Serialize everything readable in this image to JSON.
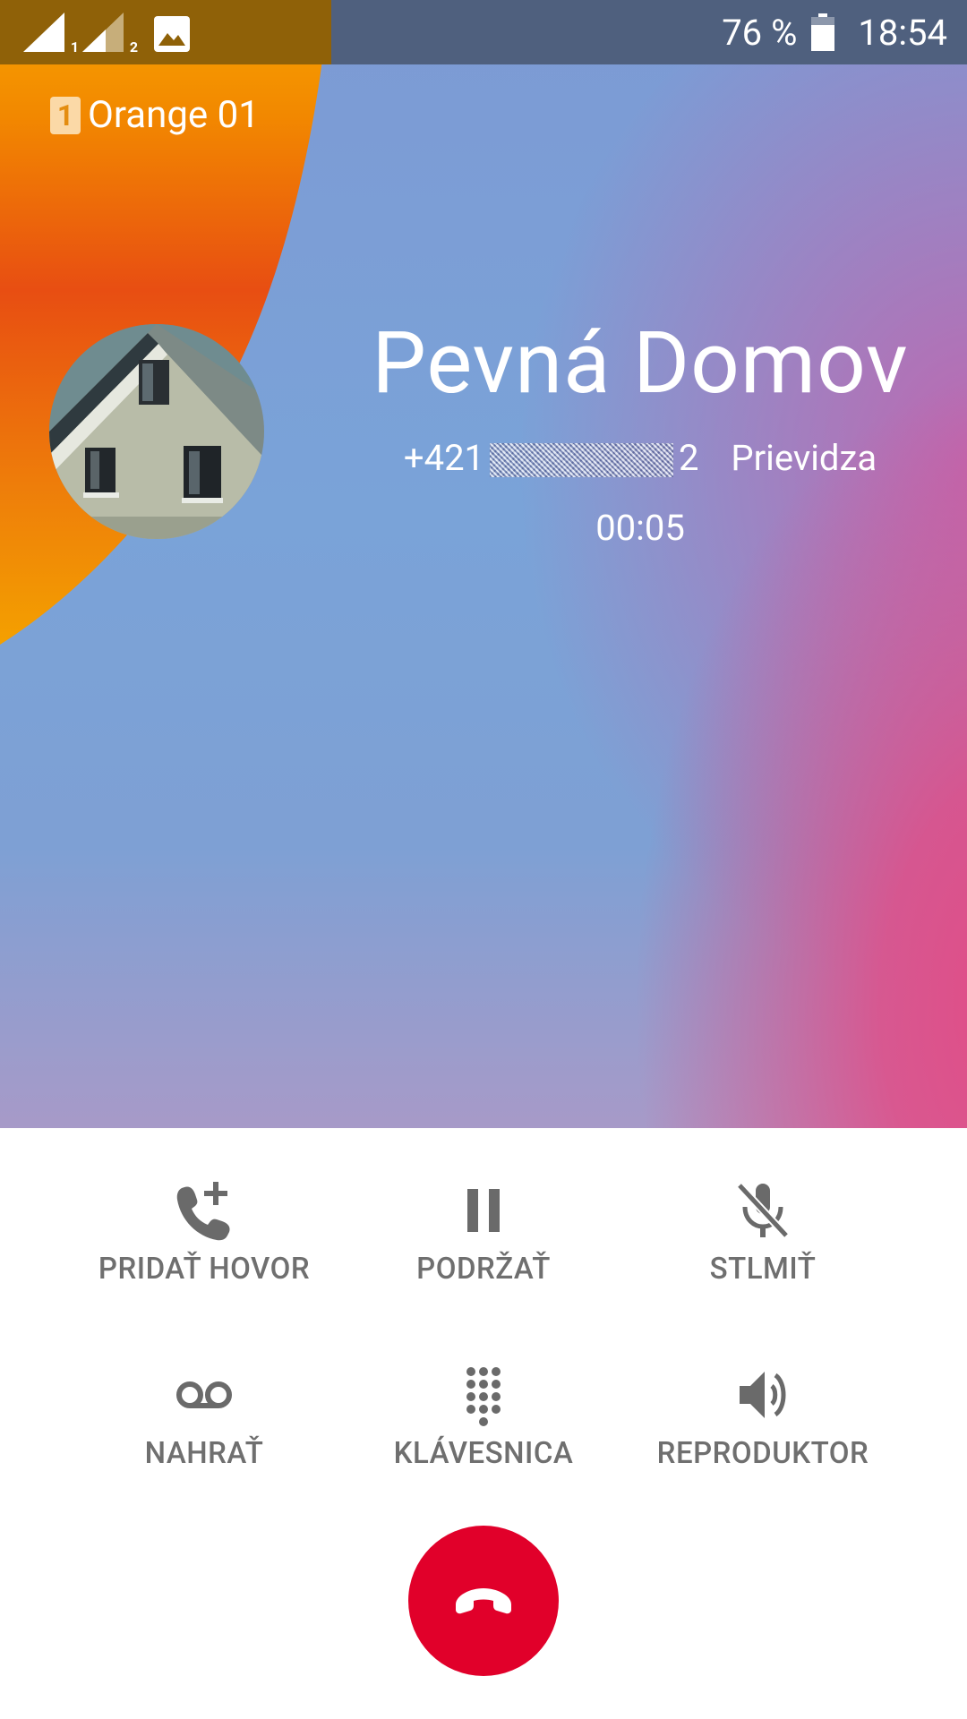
{
  "status_bar": {
    "sim1_index": "1",
    "sim2_index": "2",
    "battery": "76 %",
    "time": "18:54",
    "icons": [
      "signal-sim1-icon",
      "signal-sim2-icon",
      "gallery-notification-icon",
      "battery-icon"
    ]
  },
  "carrier": {
    "sim_slot": "1",
    "name": "Orange 01"
  },
  "contact": {
    "name": "Pevná Domov",
    "number_prefix": "+421",
    "number_suffix": "2",
    "location": "Prievidza",
    "timer": "00:05"
  },
  "controls": {
    "row1": [
      {
        "label": "PRIDAŤ HOVOR",
        "icon": "add-call-icon"
      },
      {
        "label": "PODRŽAŤ",
        "icon": "pause-icon"
      },
      {
        "label": "STLMIŤ",
        "icon": "mic-off-icon"
      }
    ],
    "row2": [
      {
        "label": "NAHRAŤ",
        "icon": "voicemail-record-icon"
      },
      {
        "label": "KLÁVESNICA",
        "icon": "dialpad-icon"
      },
      {
        "label": "REPRODUKTOR",
        "icon": "speaker-icon"
      }
    ]
  },
  "end_call": {
    "icon": "end-call-icon"
  },
  "colors": {
    "end_call": "#e1002a",
    "orange_accent": "#f39a00",
    "control_gray": "#6f6f6f"
  }
}
